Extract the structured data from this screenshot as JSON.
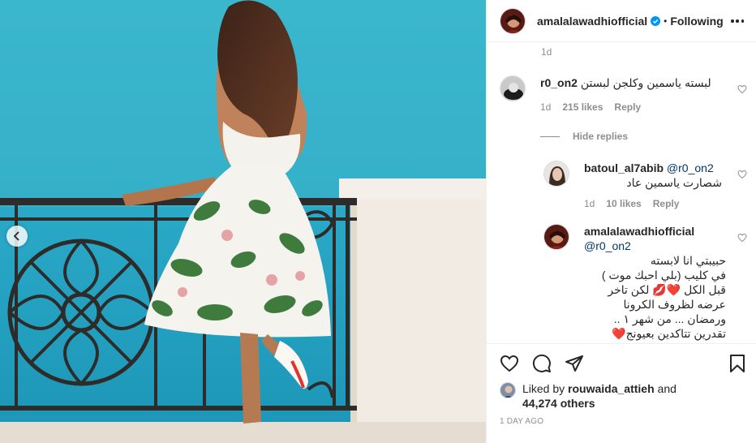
{
  "post": {
    "author": "amalalawadhiofficial",
    "separator": "•",
    "follow_state": "Following",
    "colors": {
      "accent": "#0095f6",
      "heart": "#ed4956",
      "muted": "#8e8e8e",
      "text": "#262626"
    }
  },
  "comments": {
    "truncated_time": "1d",
    "items": [
      {
        "username": "r0_on2",
        "text": "لبسته ياسمين وكلجن لبستن",
        "time": "1d",
        "likes": "215 likes",
        "reply_label": "Reply"
      }
    ],
    "hide_replies_label": "Hide replies",
    "replies": [
      {
        "username": "batoul_al7abib",
        "mention": "@r0_on2",
        "text": "شصارت ياسمين عاد",
        "time": "1d",
        "likes": "10 likes",
        "reply_label": "Reply"
      },
      {
        "username": "amalalawadhiofficial",
        "mention": "@r0_on2",
        "lines": [
          "حبيبتي انا لابسته",
          "في كليب (بلي احبك موت )",
          "قبل الكل ❤️💋 لكن تاخر",
          "عرضه لظروف الكرونا",
          "ورمضان ... من شهر ١ ..",
          "تقدرين تتاكدين بعيونج❤️"
        ]
      }
    ]
  },
  "actions": {
    "icons": [
      "heart-icon",
      "comment-icon",
      "share-icon",
      "bookmark-icon"
    ],
    "liked_by_prefix": "Liked by",
    "liked_by_user": "rouwaida_attieh",
    "liked_by_and": "and",
    "others_count": "44,274 others",
    "posted": "1 DAY AGO"
  }
}
